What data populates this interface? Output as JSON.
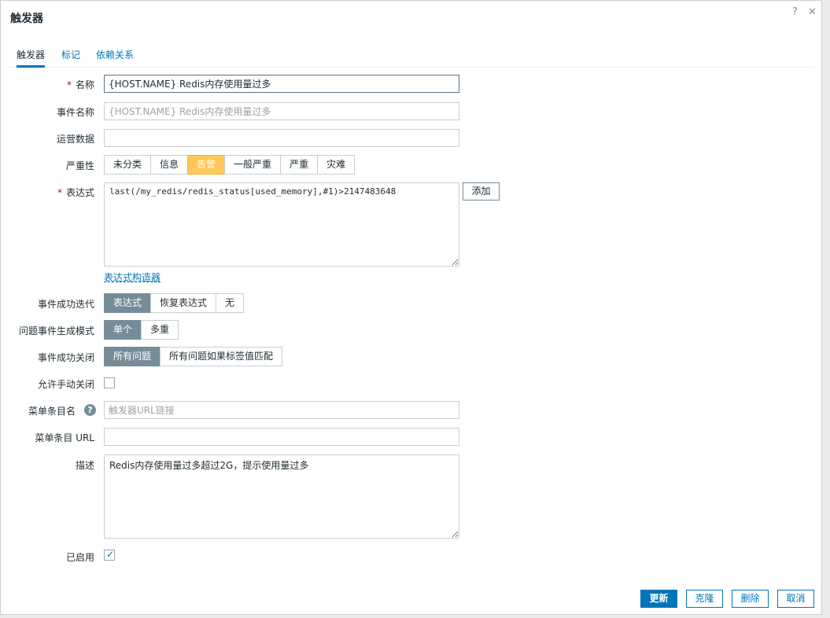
{
  "dialog": {
    "title": "触发器",
    "help_icon": "?",
    "close_icon": "✕"
  },
  "tabs": [
    {
      "label": "触发器",
      "active": true
    },
    {
      "label": "标记",
      "active": false
    },
    {
      "label": "依赖关系",
      "active": false
    }
  ],
  "form": {
    "name": {
      "label": "名称",
      "required": "*",
      "value": "{HOST.NAME} Redis内存使用量过多"
    },
    "event_name": {
      "label": "事件名称",
      "placeholder": "{HOST.NAME} Redis内存使用量过多"
    },
    "opdata": {
      "label": "运营数据",
      "value": ""
    },
    "severity": {
      "label": "严重性",
      "options": [
        "未分类",
        "信息",
        "告警",
        "一般严重",
        "严重",
        "灾难"
      ],
      "selected": "告警",
      "selected_color": "#ffc859"
    },
    "expression": {
      "label": "表达式",
      "required": "*",
      "value": "last(/my_redis/redis_status[used_memory],#1)>2147483648",
      "add_button": "添加",
      "builder_link": "表达式构造器"
    },
    "recovery": {
      "label": "事件成功迭代",
      "options": [
        "表达式",
        "恢复表达式",
        "无"
      ],
      "selected": "表达式"
    },
    "problem_mode": {
      "label": "问题事件生成模式",
      "options": [
        "单个",
        "多重"
      ],
      "selected": "单个"
    },
    "ok_close": {
      "label": "事件成功关闭",
      "options": [
        "所有问题",
        "所有问题如果标签值匹配"
      ],
      "selected": "所有问题"
    },
    "manual_close": {
      "label": "允许手动关闭",
      "checked": false
    },
    "menu_name": {
      "label": "菜单条目名",
      "placeholder": "触发器URL链接"
    },
    "menu_url": {
      "label": "菜单条目 URL",
      "value": ""
    },
    "description": {
      "label": "描述",
      "value": "Redis内存使用量过多超过2G，提示使用量过多"
    },
    "enabled": {
      "label": "已启用",
      "checked": true
    }
  },
  "footer": {
    "update": "更新",
    "clone": "克隆",
    "delete": "删除",
    "cancel": "取消"
  },
  "colors": {
    "accent": "#0275b8",
    "selected_segment": "#768d99",
    "required": "#d40000"
  }
}
